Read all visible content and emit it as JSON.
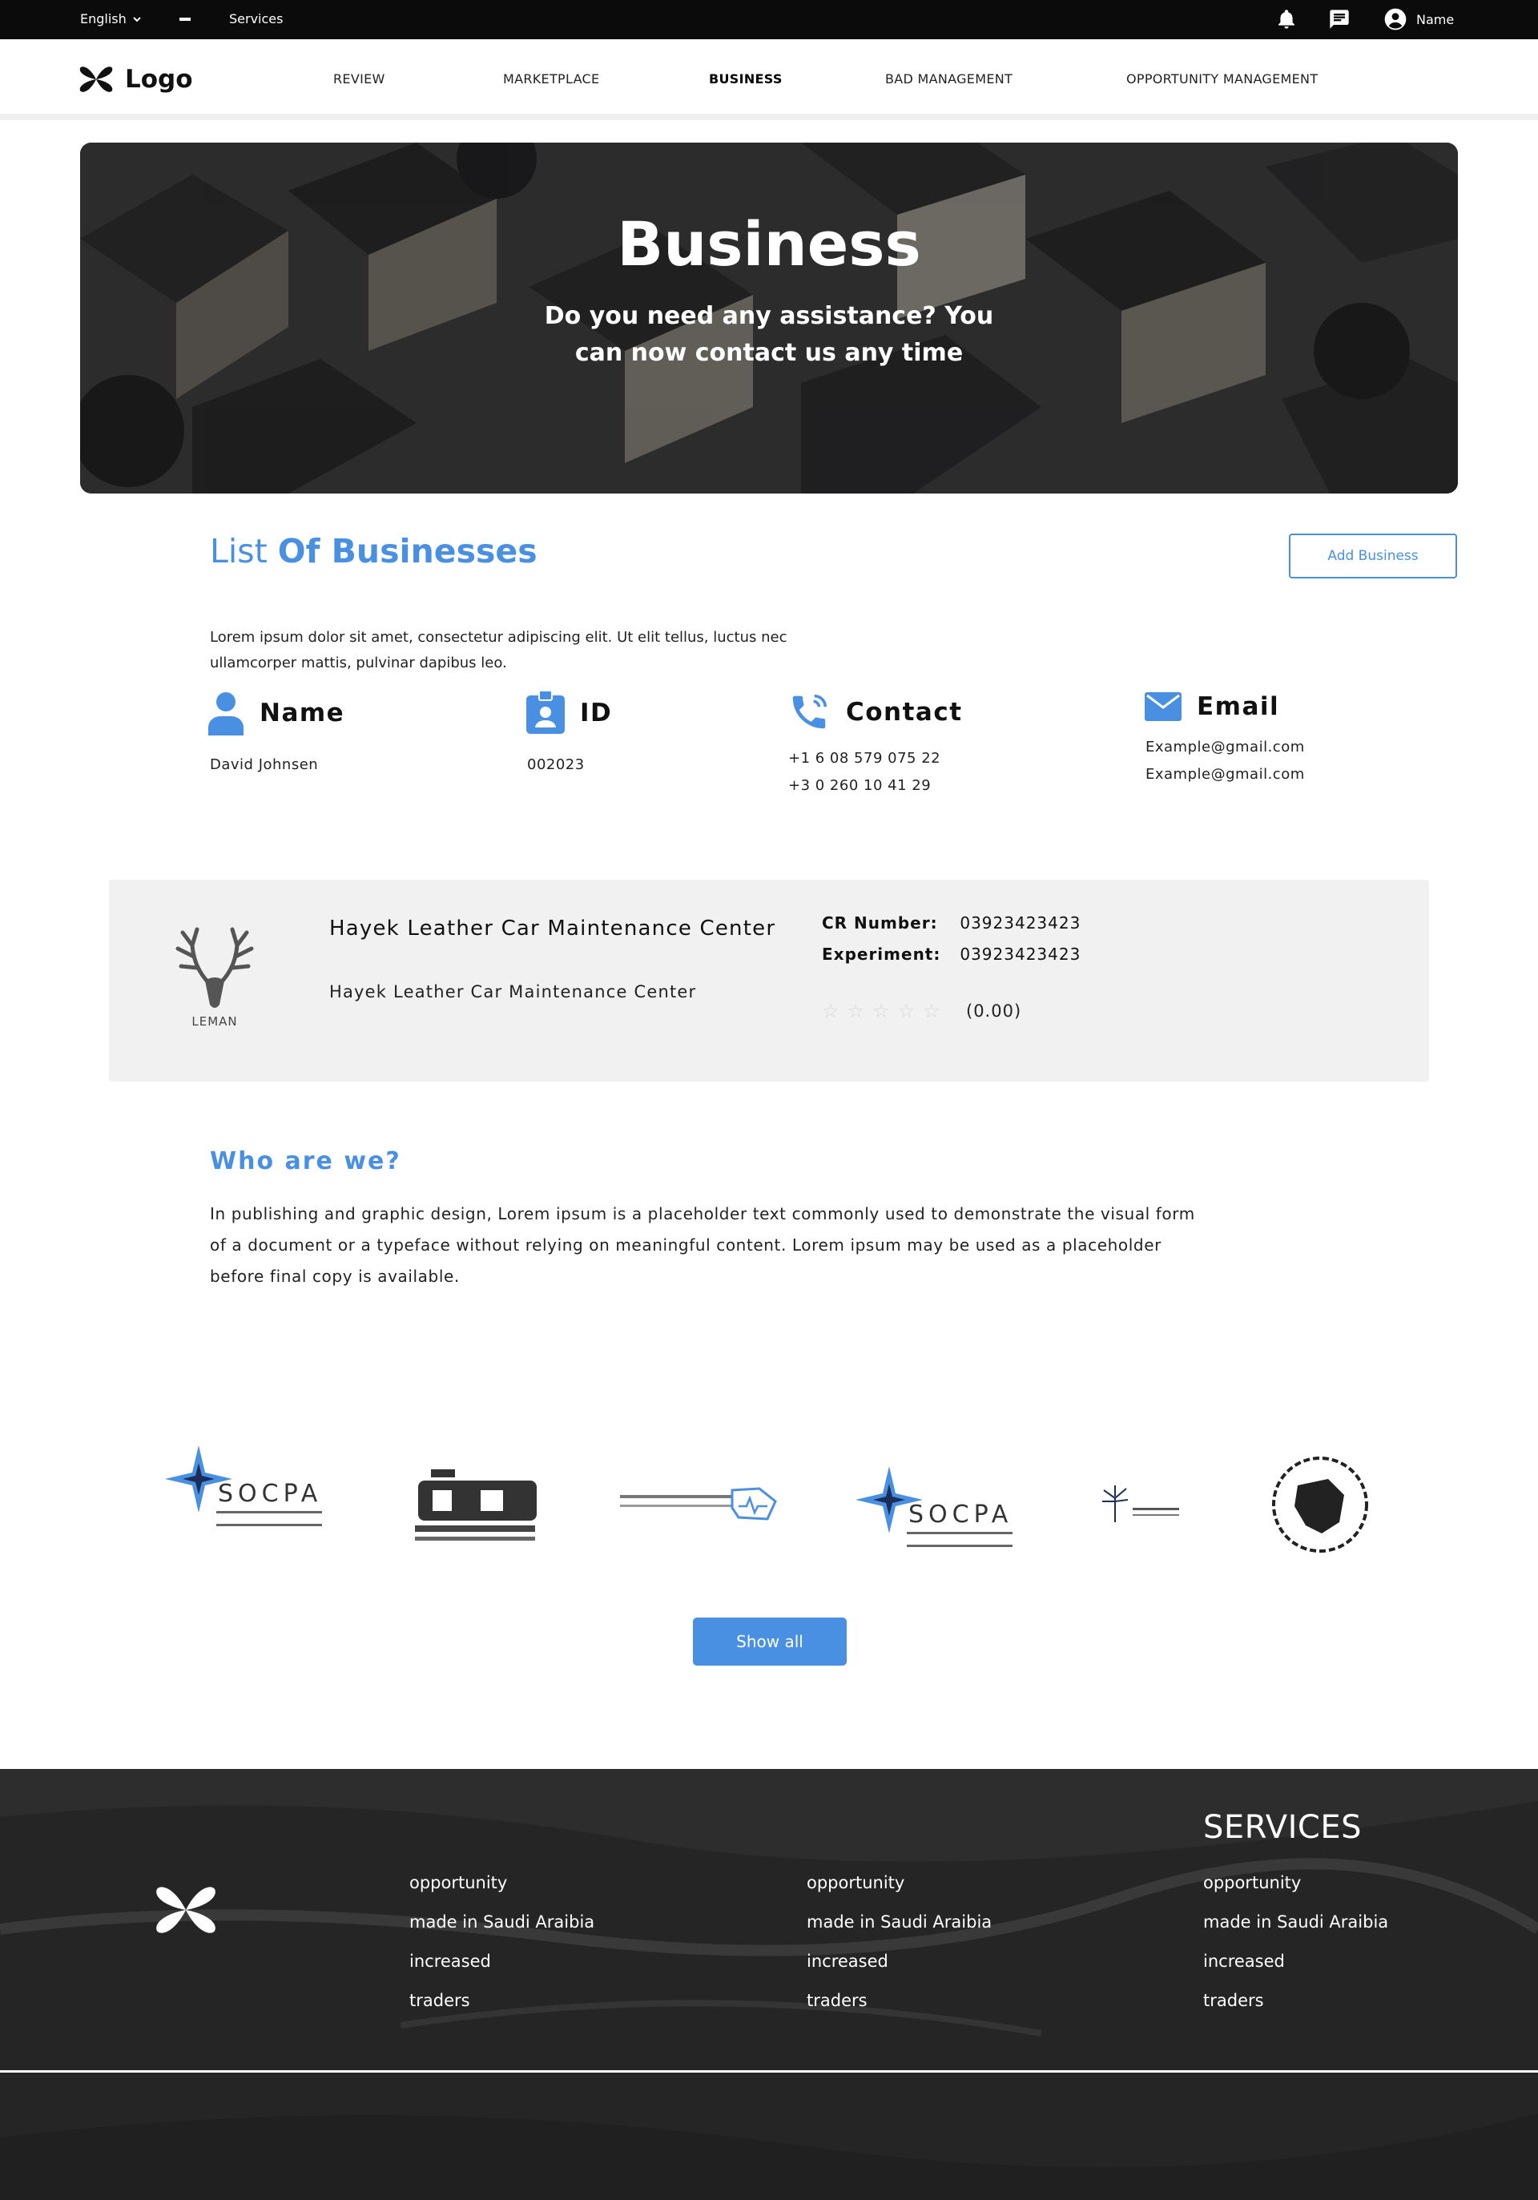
{
  "topbar": {
    "language": "English",
    "services": "Services",
    "user_name": "Name"
  },
  "nav": {
    "logo": "Logo",
    "items": [
      {
        "label": "REVIEW"
      },
      {
        "label": "MARKETPLACE"
      },
      {
        "label": "BUSINESS",
        "active": true
      },
      {
        "label": "BAD MANAGEMENT"
      },
      {
        "label": "OPPORTUNITY MANAGEMENT"
      }
    ]
  },
  "hero": {
    "title": "Business",
    "subtitle": "Do you need any assistance? You can now contact us any time"
  },
  "list": {
    "title_light": "List",
    "title_bold": "Of Businesses",
    "add_button": "Add Business",
    "intro": "Lorem ipsum dolor sit amet, consectetur adipiscing elit. Ut elit tellus, luctus nec ullamcorper mattis, pulvinar dapibus leo."
  },
  "info": {
    "name": {
      "label": "Name",
      "values": [
        "David Johnsen"
      ]
    },
    "id": {
      "label": "ID",
      "values": [
        "002023"
      ]
    },
    "contact": {
      "label": "Contact",
      "values": [
        "+1 6 08 579 075 22",
        "+3 0 260 10 41 29"
      ]
    },
    "email": {
      "label": "Email",
      "values": [
        "Example@gmail.com",
        "Example@gmail.com"
      ]
    }
  },
  "card": {
    "logo_text": "LEMAN",
    "name": "Hayek Leather Car Maintenance Center",
    "subtitle": "Hayek Leather Car Maintenance Center",
    "cr_label": "CR Number:",
    "cr_value": "03923423423",
    "exp_label": "Experiment:",
    "exp_value": "03923423423",
    "rating": 0,
    "rating_text": "(0.00)"
  },
  "who": {
    "title": "Who are we?",
    "text": "In publishing and graphic design, Lorem ipsum is a placeholder text commonly used to demonstrate the visual form of a document or a typeface without relying on meaningful content. Lorem ipsum may be used as a placeholder before final copy is available."
  },
  "partners": {
    "socpa": "SOCPA",
    "show_all": "Show all"
  },
  "footer": {
    "col3_title": "SERVICES",
    "links": [
      "opportunity",
      "made in Saudi Araibia",
      "increased",
      "traders"
    ]
  },
  "colors": {
    "accent": "#4a90e2",
    "topbar": "#0b0b0b",
    "card": "#f1f1f1"
  }
}
